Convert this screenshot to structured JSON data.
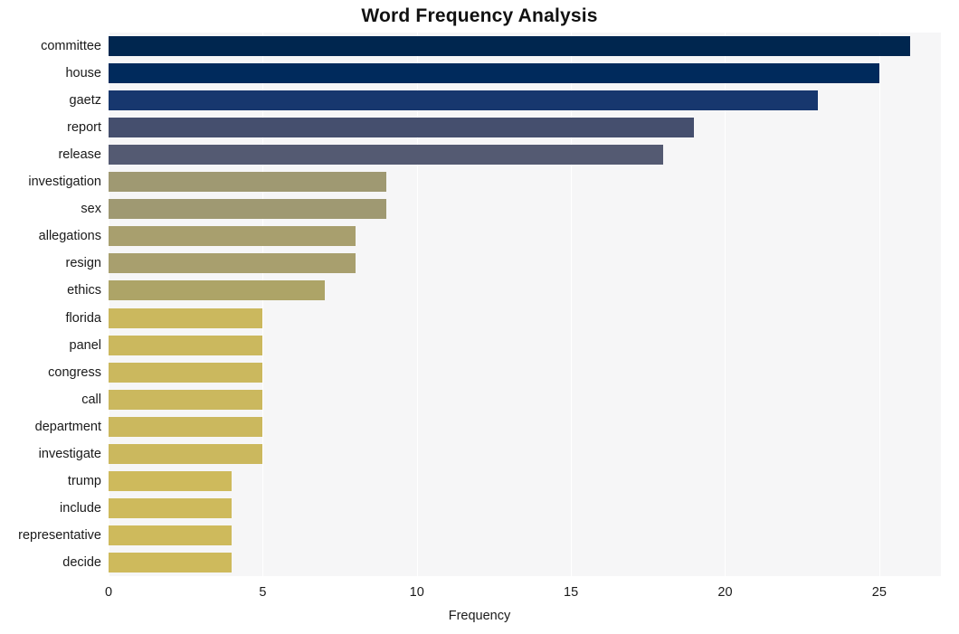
{
  "chart_data": {
    "type": "bar",
    "orientation": "horizontal",
    "title": "Word Frequency Analysis",
    "xlabel": "Frequency",
    "ylabel": "",
    "xlim": [
      0,
      27
    ],
    "ylim": null,
    "grid": true,
    "legend": null,
    "xticks": [
      0,
      5,
      10,
      15,
      20,
      25
    ],
    "xtick_labels": [
      "0",
      "5",
      "10",
      "15",
      "20",
      "25"
    ],
    "categories": [
      "committee",
      "house",
      "gaetz",
      "report",
      "release",
      "investigation",
      "sex",
      "allegations",
      "resign",
      "ethics",
      "florida",
      "panel",
      "congress",
      "call",
      "department",
      "investigate",
      "trump",
      "include",
      "representative",
      "decide"
    ],
    "values": [
      26,
      25,
      23,
      19,
      18,
      9,
      9,
      8,
      8,
      7,
      5,
      5,
      5,
      5,
      5,
      5,
      4,
      4,
      4,
      4
    ],
    "bar_colors": [
      "#00264f",
      "#002a5c",
      "#17376e",
      "#454f6e",
      "#545a72",
      "#9f9972",
      "#9f9972",
      "#a89f6e",
      "#a89f6e",
      "#ada467",
      "#cbb85e",
      "#cbb85e",
      "#cbb85e",
      "#cbb85e",
      "#cbb85e",
      "#cbb85e",
      "#ceba5c",
      "#ceba5c",
      "#ceba5c",
      "#ceba5c"
    ]
  },
  "style": {
    "plot_background": "#f6f6f7",
    "figure_background": "#ffffff",
    "gridline_color": "#ffffff",
    "text_color": "#1a1a1a"
  }
}
